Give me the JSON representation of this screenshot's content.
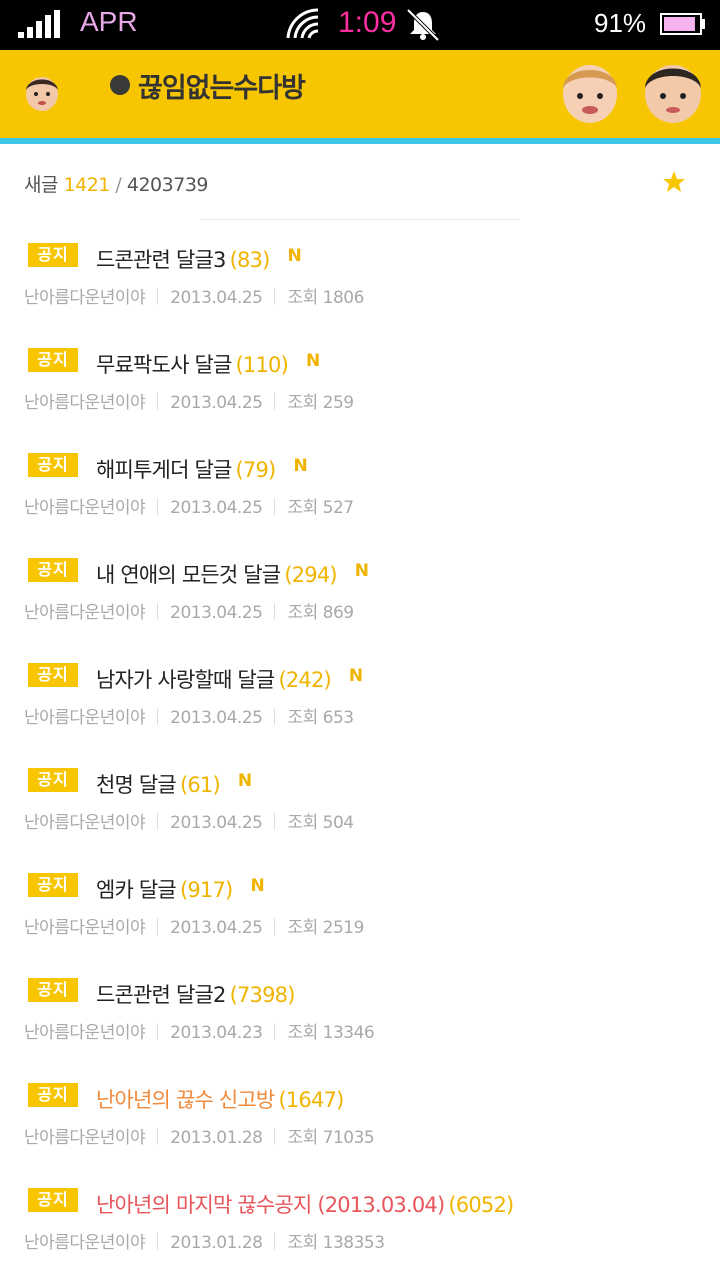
{
  "status_bar": {
    "carrier": "APR",
    "time": "1:09",
    "battery_percent": "91%",
    "battery_level": 0.91,
    "icons": [
      "signal-icon",
      "wifi-icon",
      "alarm-bell-icon",
      "battery-icon"
    ]
  },
  "header": {
    "title": "끊임없는수다방",
    "accent_color": "#f7c600",
    "stripe_color": "#3fc6e5"
  },
  "board": {
    "new_label": "새글",
    "new_count": "1421",
    "separator": "/",
    "total_count": "4203739"
  },
  "posts": [
    {
      "badge": "공지",
      "title": "드콘관련 달글3",
      "count": "(83)",
      "new_mark": "N",
      "author": "난아름다운년이야",
      "date": "2013.04.25",
      "views": "조회 1806",
      "style": "normal"
    },
    {
      "badge": "공지",
      "title": "무료팍도사 달글",
      "count": "(110)",
      "new_mark": "N",
      "author": "난아름다운년이야",
      "date": "2013.04.25",
      "views": "조회 259",
      "style": "normal"
    },
    {
      "badge": "공지",
      "title": "해피투게더 달글",
      "count": "(79)",
      "new_mark": "N",
      "author": "난아름다운년이야",
      "date": "2013.04.25",
      "views": "조회 527",
      "style": "normal"
    },
    {
      "badge": "공지",
      "title": "내 연애의 모든것 달글",
      "count": "(294)",
      "new_mark": "N",
      "author": "난아름다운년이야",
      "date": "2013.04.25",
      "views": "조회 869",
      "style": "normal"
    },
    {
      "badge": "공지",
      "title": "남자가 사랑할때 달글",
      "count": "(242)",
      "new_mark": "N",
      "author": "난아름다운년이야",
      "date": "2013.04.25",
      "views": "조회 653",
      "style": "normal"
    },
    {
      "badge": "공지",
      "title": "천명 달글",
      "count": "(61)",
      "new_mark": "N",
      "author": "난아름다운년이야",
      "date": "2013.04.25",
      "views": "조회 504",
      "style": "normal"
    },
    {
      "badge": "공지",
      "title": "엠카 달글",
      "count": "(917)",
      "new_mark": "N",
      "author": "난아름다운년이야",
      "date": "2013.04.25",
      "views": "조회 2519",
      "style": "normal"
    },
    {
      "badge": "공지",
      "title": "드콘관련 달글2",
      "count": "(7398)",
      "new_mark": "",
      "author": "난아름다운년이야",
      "date": "2013.04.23",
      "views": "조회 13346",
      "style": "normal"
    },
    {
      "badge": "공지",
      "title": "난아년의 끊수 신고방",
      "count": "(1647)",
      "new_mark": "",
      "author": "난아름다운년이야",
      "date": "2013.01.28",
      "views": "조회 71035",
      "style": "orange"
    },
    {
      "badge": "공지",
      "title": "난아년의 마지막 끊수공지 (2013.03.04)",
      "count": "(6052)",
      "new_mark": "",
      "author": "난아름다운년이야",
      "date": "2013.01.28",
      "views": "조회 138353",
      "style": "red"
    }
  ]
}
